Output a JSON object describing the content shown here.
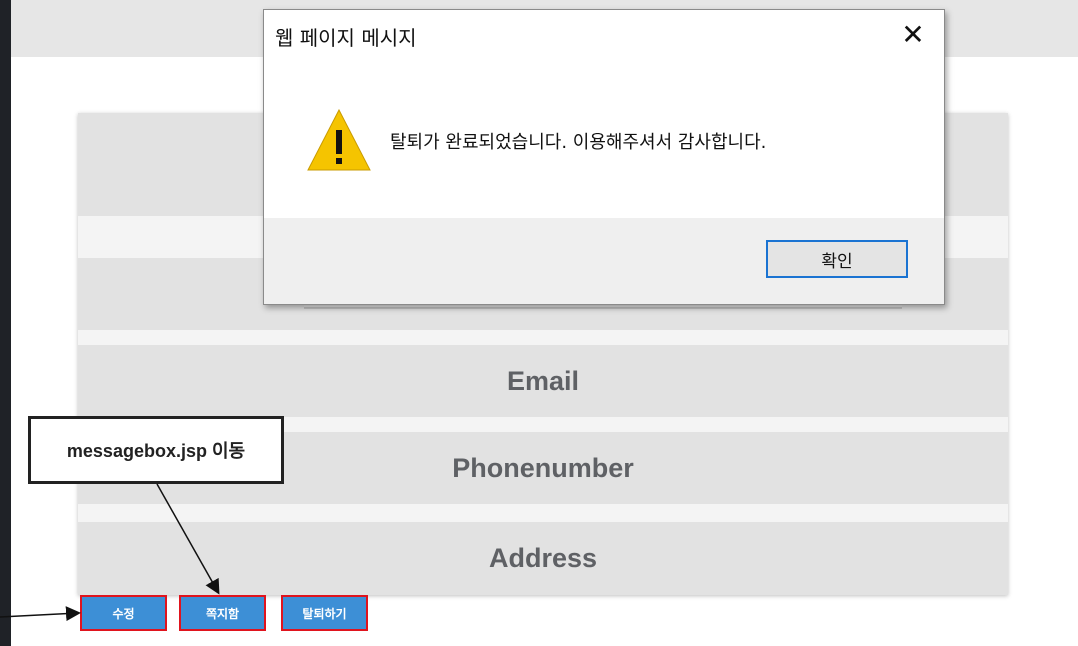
{
  "form": {
    "rows": [
      "",
      "",
      "Email",
      "Phonenumber",
      "Address"
    ]
  },
  "buttons": {
    "edit": "수정",
    "messagebox": "쪽지함",
    "withdraw": "탈퇴하기"
  },
  "annotation": {
    "label": "messagebox.jsp 이동"
  },
  "dialog": {
    "title": "웹 페이지 메시지",
    "close": "✕",
    "message": "탈퇴가 완료되었습니다. 이용해주셔서 감사합니다.",
    "ok_label": "확인",
    "icon": "warning-icon"
  },
  "colors": {
    "button_blue": "#3d8fd6",
    "highlight_red": "#e0141e",
    "warning_yellow": "#f5c400",
    "ok_border": "#1a73d2"
  }
}
